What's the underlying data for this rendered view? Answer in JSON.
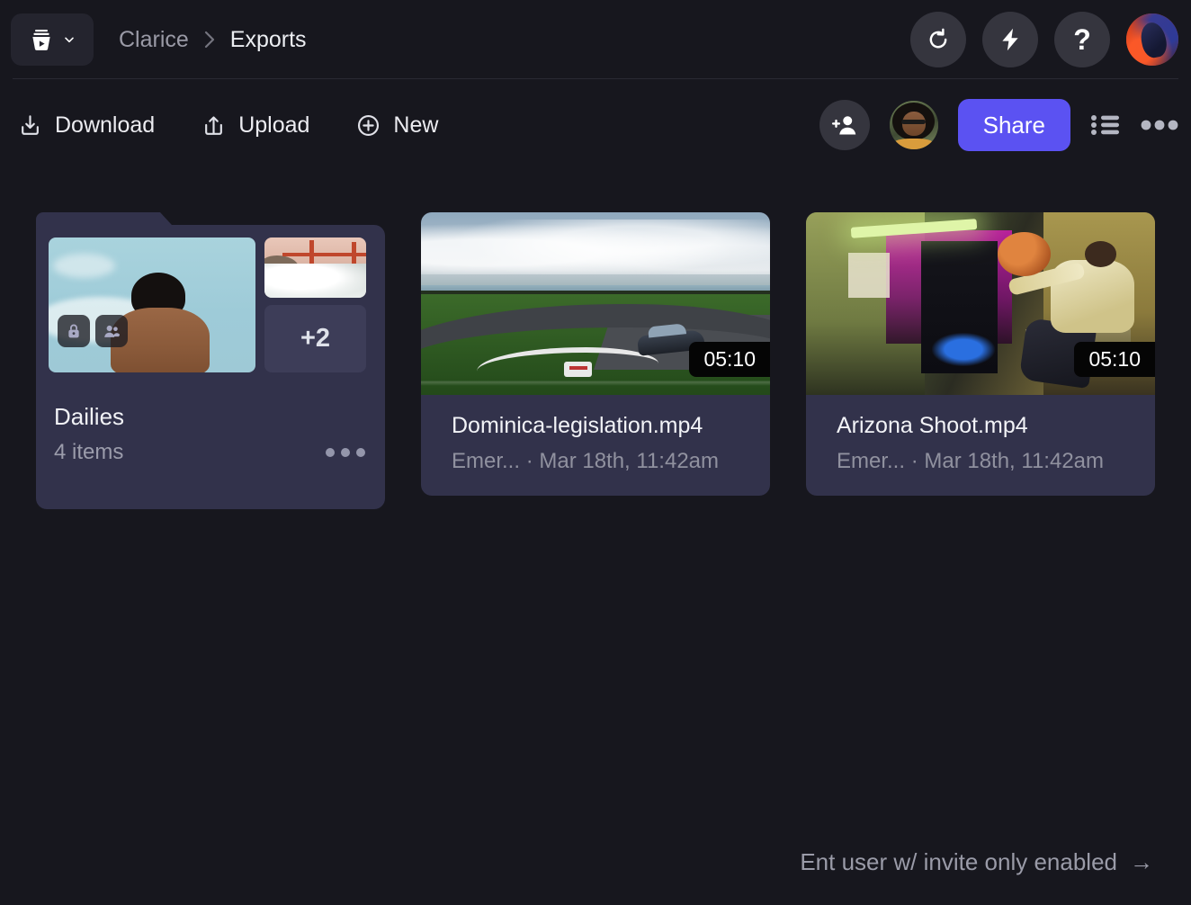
{
  "header": {
    "brand_icon": "frameio-cup-logo-icon",
    "brand_chevron_icon": "chevron-down-icon",
    "breadcrumb": {
      "parent": "Clarice",
      "separator": "›",
      "current": "Exports"
    },
    "actions": [
      {
        "name": "refresh",
        "icon": "refresh-circular-arrow-icon"
      },
      {
        "name": "activity",
        "icon": "lightning-bolt-icon"
      },
      {
        "name": "help",
        "icon": "question-mark-icon",
        "glyph": "?"
      }
    ],
    "profile_avatar": "user-profile-avatar"
  },
  "toolbar": {
    "download_label": "Download",
    "download_icon": "download-icon",
    "upload_label": "Upload",
    "upload_icon": "upload-share-icon",
    "new_label": "New",
    "new_icon": "plus-circle-icon",
    "invite_icon": "add-person-icon",
    "member_avatar": "collaborator-avatar",
    "share_label": "Share",
    "list_view_icon": "list-view-icon",
    "more_icon": "more-horizontal-icon"
  },
  "colors": {
    "page_bg": "#17171e",
    "card_bg": "#32324b",
    "accent": "#5b52f2",
    "text_primary": "#f1f2f6",
    "text_secondary": "#90919f"
  },
  "items": [
    {
      "type": "folder",
      "title": "Dailies",
      "subtitle": "4 items",
      "overflow_count": "+2",
      "badges": [
        "lock-icon",
        "people-group-icon"
      ],
      "more_icon": "more-horizontal-icon"
    },
    {
      "type": "file",
      "name": "Dominica-legislation.mp4",
      "meta": "Emer... · Mar 18th, 11:42am",
      "duration": "05:10",
      "thumbnail": "race-track-with-car"
    },
    {
      "type": "file",
      "name": "Arizona Shoot.mp4",
      "meta": "Emer... · Mar 18th, 11:42am",
      "duration": "05:10",
      "thumbnail": "neon-room-with-basketball"
    }
  ],
  "footer": {
    "note": "Ent user w/ invite only enabled",
    "arrow": "→",
    "arrow_icon": "arrow-right-icon"
  }
}
